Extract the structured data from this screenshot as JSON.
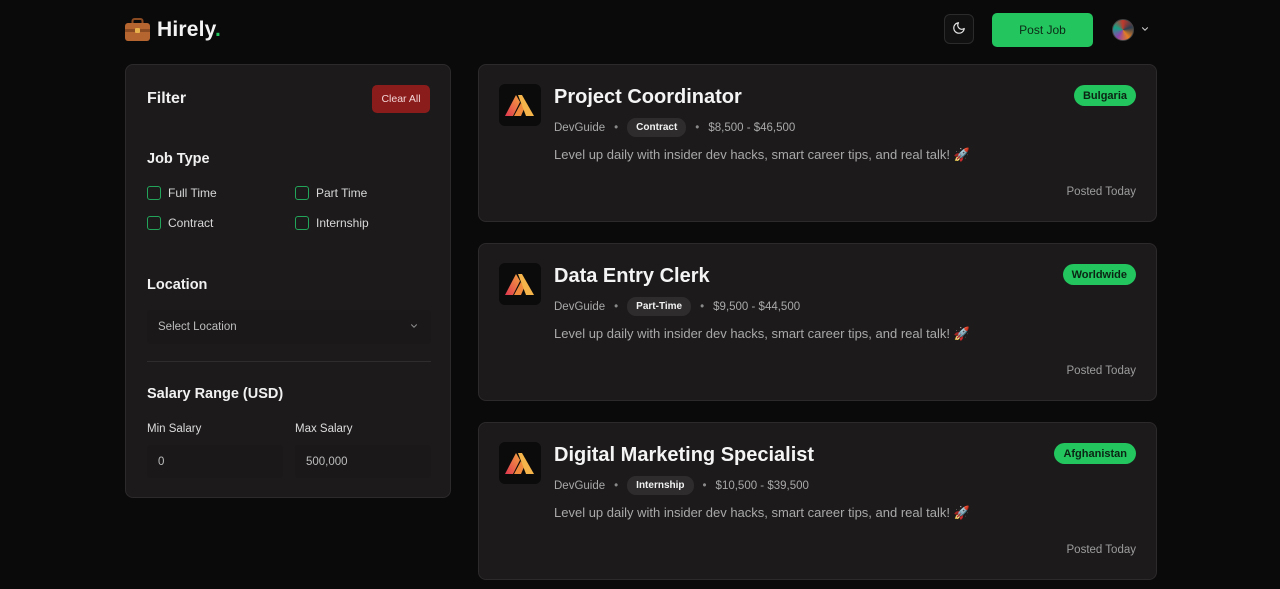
{
  "header": {
    "logo_text": "Hirely",
    "logo_dot": ".",
    "post_job_label": "Post Job",
    "theme_icon": "moon-icon",
    "avatar_icon": "avatar",
    "accent_color": "#22c55e"
  },
  "filter": {
    "title": "Filter",
    "clear_label": "Clear All",
    "job_type": {
      "title": "Job Type",
      "options": [
        "Full Time",
        "Part Time",
        "Contract",
        "Internship"
      ]
    },
    "location": {
      "title": "Location",
      "placeholder": "Select Location"
    },
    "salary": {
      "title": "Salary Range (USD)",
      "min_label": "Min Salary",
      "max_label": "Max Salary",
      "min_value": "0",
      "max_value": "500,000"
    }
  },
  "jobs": [
    {
      "title": "Project Coordinator",
      "company": "DevGuide",
      "type": "Contract",
      "salary": "$8,500 - $46,500",
      "location": "Bulgaria",
      "description": "Level up daily with insider dev hacks, smart career tips, and real talk! 🚀",
      "posted": "Posted Today"
    },
    {
      "title": "Data Entry Clerk",
      "company": "DevGuide",
      "type": "Part-Time",
      "salary": "$9,500 - $44,500",
      "location": "Worldwide",
      "description": "Level up daily with insider dev hacks, smart career tips, and real talk! 🚀",
      "posted": "Posted Today"
    },
    {
      "title": "Digital Marketing Specialist",
      "company": "DevGuide",
      "type": "Internship",
      "salary": "$10,500 - $39,500",
      "location": "Afghanistan",
      "description": "Level up daily with insider dev hacks, smart career tips, and real talk! 🚀",
      "posted": "Posted Today"
    }
  ]
}
